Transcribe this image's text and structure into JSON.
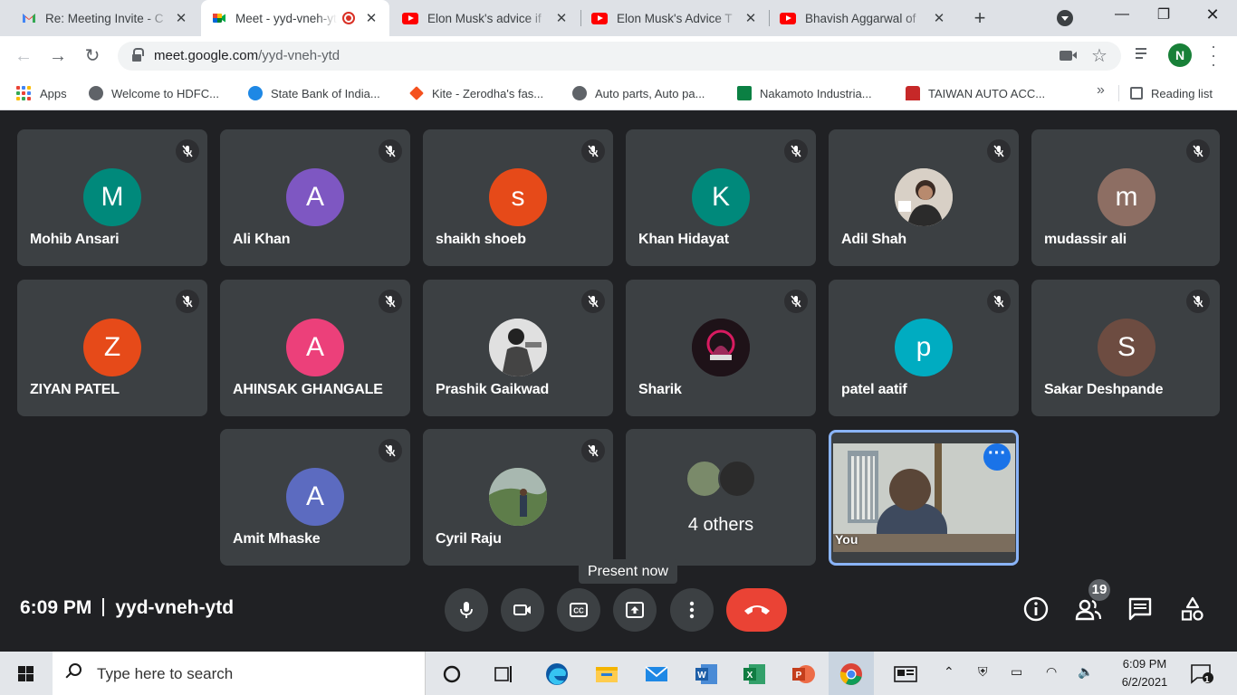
{
  "browser": {
    "tabs": [
      {
        "title": "Re: Meeting Invite - C",
        "favicon": "gmail-icon"
      },
      {
        "title": "Meet - yyd-vneh-ytd",
        "favicon": "meet-icon",
        "active": true
      },
      {
        "title": "Elon Musk's advice if",
        "favicon": "youtube-icon"
      },
      {
        "title": "Elon Musk's Advice T",
        "favicon": "youtube-icon"
      },
      {
        "title": "Bhavish Aggarwal of",
        "favicon": "youtube-icon"
      }
    ],
    "url_host": "meet.google.com",
    "url_path": "/yyd-vneh-ytd",
    "profile_initial": "N",
    "bookmarks": [
      {
        "label": "Apps"
      },
      {
        "label": "Welcome to HDFC..."
      },
      {
        "label": "State Bank of India..."
      },
      {
        "label": "Kite - Zerodha's fas..."
      },
      {
        "label": "Auto parts, Auto pa..."
      },
      {
        "label": "Nakamoto Industria..."
      },
      {
        "label": "TAIWAN AUTO ACC..."
      }
    ],
    "reading_list": "Reading list"
  },
  "meet": {
    "participants": [
      {
        "name": "Mohib Ansari",
        "initial": "M",
        "color": "#00897b"
      },
      {
        "name": "Ali Khan",
        "initial": "A",
        "color": "#7e57c2"
      },
      {
        "name": "shaikh shoeb",
        "initial": "s",
        "color": "#e64a19"
      },
      {
        "name": "Khan Hidayat",
        "initial": "K",
        "color": "#00897b"
      },
      {
        "name": "Adil Shah",
        "initial": "",
        "color": "#c7b8a8"
      },
      {
        "name": "mudassir ali",
        "initial": "m",
        "color": "#8d6e63"
      },
      {
        "name": "ZIYAN PATEL",
        "initial": "Z",
        "color": "#e64a19"
      },
      {
        "name": "AHINSAK GHANGALE",
        "initial": "A",
        "color": "#ec407a"
      },
      {
        "name": "Prashik Gaikwad",
        "initial": "",
        "color": "#9e9e9e"
      },
      {
        "name": "Sharik",
        "initial": "",
        "color": "#3a1f2e"
      },
      {
        "name": "patel aatif",
        "initial": "p",
        "color": "#00acc1"
      },
      {
        "name": "Sakar Deshpande",
        "initial": "S",
        "color": "#6d4c41"
      },
      {
        "name": "Amit Mhaske",
        "initial": "A",
        "color": "#5c6bc0"
      },
      {
        "name": "Cyril Raju",
        "initial": "",
        "color": "#6b8e5a"
      }
    ],
    "others_label": "4 others",
    "self_label": "You",
    "present_tooltip": "Present now",
    "time": "6:09 PM",
    "meeting_code": "yyd-vneh-ytd",
    "people_count": "19"
  },
  "taskbar": {
    "search_placeholder": "Type here to search",
    "time": "6:09 PM",
    "date": "6/2/2021",
    "notification_count": "1"
  }
}
